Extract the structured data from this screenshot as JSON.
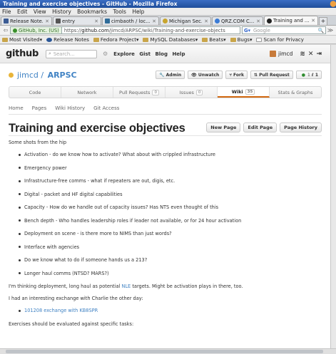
{
  "window": {
    "title": "Training and exercise objectives - GitHub - Mozilla Firefox"
  },
  "menu": [
    "File",
    "Edit",
    "View",
    "History",
    "Bookmarks",
    "Tools",
    "Help"
  ],
  "tabs": [
    {
      "label": "Release Note...",
      "color": "#3b5b94",
      "active": false
    },
    {
      "label": "entry",
      "color": "#555555",
      "active": false
    },
    {
      "label": "cimbaoth / loc...",
      "color": "#2f6c99",
      "active": false
    },
    {
      "label": "Michigan Sec...",
      "color": "#c8a52e",
      "active": false
    },
    {
      "label": "QRZ.COM C...",
      "color": "#3a7bd5",
      "active": false
    },
    {
      "label": "Training and ...",
      "color": "#222222",
      "active": true
    }
  ],
  "nav": {
    "identity": "GitHub, Inc. (US)",
    "url_prefix": "https://",
    "url_domain": "github.com",
    "url_path": "/jimcd/ARPSC/wiki/Training-and-exercise-objects",
    "search_engine": "Google",
    "search_placeholder": "Google"
  },
  "bookmarks": [
    "Most Visited",
    "Release Notes",
    "Fedora Project",
    "MySQL Databases",
    "Beats",
    "Bugs",
    "Scan for Privacy"
  ],
  "github": {
    "logo": "github",
    "search_placeholder": "Search...",
    "nav": [
      "Explore",
      "Gist",
      "Blog",
      "Help"
    ],
    "user": "jimcd",
    "repo_owner": "jimcd",
    "repo_name": "ARPSC",
    "repo_buttons": [
      {
        "label": "Admin",
        "count": ""
      },
      {
        "label": "Unwatch",
        "count": ""
      },
      {
        "label": "Fork",
        "count": ""
      },
      {
        "label": "Pull Request",
        "count": ""
      },
      {
        "label": "",
        "count": "1"
      }
    ],
    "repo_tabs": [
      {
        "label": "Code",
        "badge": "",
        "active": false
      },
      {
        "label": "Network",
        "badge": "",
        "active": false
      },
      {
        "label": "Pull Requests",
        "badge": "0",
        "active": false
      },
      {
        "label": "Issues",
        "badge": "0",
        "active": false
      },
      {
        "label": "Wiki",
        "badge": "35",
        "active": true
      },
      {
        "label": "Stats & Graphs",
        "badge": "",
        "active": false
      }
    ],
    "subnav": [
      "Home",
      "Pages",
      "Wiki History",
      "Git Access"
    ],
    "page_title": "Training and exercise objectives",
    "page_buttons": [
      "New Page",
      "Edit Page",
      "Page History"
    ],
    "intro": "Some shots from the hip",
    "bullets": [
      "Activation - do we know how to activate? What about with crippled infrastructure",
      "Emergency power",
      "Infrastructure-free comms - what if repeaters are out, digis, etc.",
      "Digital - packet and HF digital capabilities",
      "Capacity - How do we handle out of capacity issues? Has NTS even thought of this",
      "Bench depth - Who handles leadership roles if leader not available, or for 24 hour activation",
      "Deployment on scene - is there more to NIMS than just words?",
      "Interface with agencies",
      "Do we know what to do if someone hands us a 213?",
      "Longer haul comms (NTSD? MARS?)"
    ],
    "para2_before": "I'm thinking deployment, long haul as potential ",
    "para2_link": "NLE",
    "para2_after": " targets. Might be activation plays in there, too.",
    "para3": "I had an interesting exchange with Charlie the other day:",
    "link_bullet": "101208 exchange with KB8SPR",
    "para4": "Exercises should be evaluated against specific tasks:"
  }
}
